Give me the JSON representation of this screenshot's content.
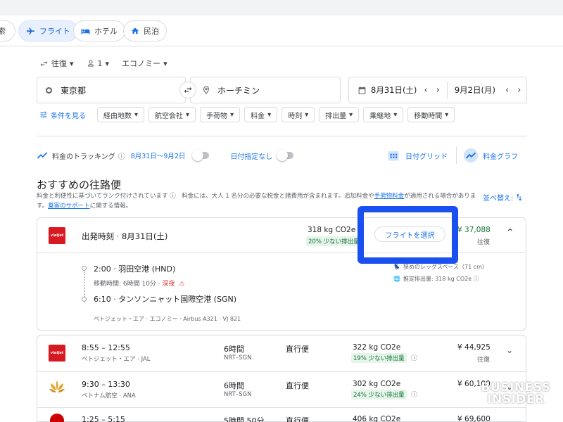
{
  "nav": {
    "partial_label": "索",
    "tabs": [
      {
        "label": "フライト",
        "icon": "plane-icon",
        "active": true
      },
      {
        "label": "ホテル",
        "icon": "bed-icon",
        "active": false
      },
      {
        "label": "民泊",
        "icon": "home-icon",
        "active": false
      }
    ]
  },
  "search": {
    "trip_type": "往復",
    "passengers": "1",
    "cabin": "エコノミー",
    "origin": "東京都",
    "destination": "ホーチミン",
    "depart_date": "8月31日(土)",
    "return_date": "9月2日(月)"
  },
  "filters": {
    "all_filters": "条件を見る",
    "chips": [
      "経由地数",
      "航空会社",
      "手荷物",
      "料金",
      "時刻",
      "排出量",
      "乗継地",
      "移動時間"
    ]
  },
  "tracking": {
    "label": "料金のトラッキング",
    "date_range": "8月31日〜9月2日",
    "any_dates": "日付指定なし",
    "date_grid": "日付グリッド",
    "price_graph": "料金グラフ"
  },
  "results": {
    "title": "おすすめの往路便",
    "desc_text": "料金と利便性に基づいてランク付けされています ⓘ　料金には、大人 1 名分の必要な税金と諸費用が含まれます。追加料金や",
    "desc_link1": "手荷物料金",
    "desc_text2": "が適用される場合があります。",
    "desc_link2": "乗客のサポート",
    "desc_text3": "に関する情報。",
    "sort_label": "並べ替え:"
  },
  "expanded": {
    "header": "出発時刻 · 8月31日(土)",
    "emissions": "318 kg CO2e",
    "emissions_badge": "20% 少ない排出量",
    "select_button": "フライトを選択",
    "price": "¥ 37,088",
    "price_note": "往復",
    "dep_time": "2:00 · 羽田空港 (HND)",
    "travel_time": "移動時間: 6時間 10分 · ",
    "overnight": "深夜",
    "arr_time": "6:10 · タンソンニャット国際空港 (SGN)",
    "details": "ベトジェット・エア · エコノミー · Airbus A321 · VJ 821",
    "legroom": "狭めのレッグスペース（71 cm）",
    "est_emissions": "推定排出量: 318 kg CO2e ⓘ"
  },
  "flights": [
    {
      "time": "8:55 – 12:55",
      "airline": "ベトジェット・エア · JAL",
      "duration": "6時間",
      "route": "NRT–SGN",
      "stops": "直行便",
      "co2": "322 kg CO2e",
      "co2_badge": "19% 少ない排出量",
      "price": "¥ 44,925",
      "price_note": "往復",
      "logo": "vietjet"
    },
    {
      "time": "9:30 – 13:30",
      "airline": "ベトナム航空 · ANA",
      "duration": "6時間",
      "route": "NRT–SGN",
      "stops": "直行便",
      "co2": "302 kg CO2e",
      "co2_badge": "24% 少ない排出量",
      "price": "¥ 60,100",
      "price_note": "",
      "logo": "vietnam"
    },
    {
      "time": "1:25 – 5:15",
      "airline": "",
      "duration": "5時間 50分",
      "route": "",
      "stops": "直行便",
      "co2": "406 kg CO2e",
      "co2_badge": "",
      "price": "¥ 69,600",
      "price_note": "",
      "logo": "jal"
    }
  ],
  "watermark": {
    "line1": "BUSINESS",
    "line2": "INSIDER"
  },
  "colors": {
    "accent": "#1a73e8",
    "highlight": "#1a4ff0",
    "green": "#137333",
    "vietjet": "#d71920"
  }
}
